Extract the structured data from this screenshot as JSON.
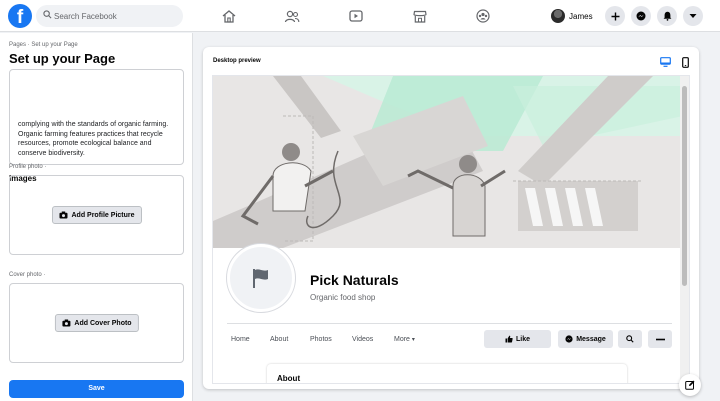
{
  "topbar": {
    "logo": "f",
    "search": {
      "placeholder": "Search Facebook",
      "value": ""
    },
    "nav_icons": [
      "home-icon",
      "friends-icon",
      "watch-icon",
      "marketplace-icon",
      "groups-icon"
    ],
    "profile_name": "James",
    "right_icons": [
      "plus-icon",
      "messenger-icon",
      "notifications-icon",
      "chevron-down-icon"
    ]
  },
  "left_panel": {
    "breadcrumb": "Pages · Set up your Page",
    "title": "Set up your Page",
    "description_text": "complying with the standards of organic farming. Organic farming features practices that recycle resources, promote ecological balance and conserve biodiversity.",
    "images_heading": "Images",
    "profile_photo_label": "Profile photo ·",
    "add_profile_picture": "Add Profile Picture",
    "cover_photo_label": "Cover photo ·",
    "add_cover_photo": "Add Cover Photo",
    "save_label": "Save"
  },
  "preview": {
    "label": "Desktop preview",
    "view_modes": [
      "desktop-icon",
      "mobile-icon"
    ],
    "page_name": "Pick Naturals",
    "category": "Organic food shop",
    "tabs": [
      "Home",
      "About",
      "Photos",
      "Videos",
      "More"
    ],
    "more_caret": "▾",
    "like_label": "Like",
    "message_label": "Message",
    "about_heading": "About"
  },
  "colors": {
    "brand": "#1877f2",
    "cover_accent": "#b9ead3",
    "background": "#f0f2f5"
  }
}
